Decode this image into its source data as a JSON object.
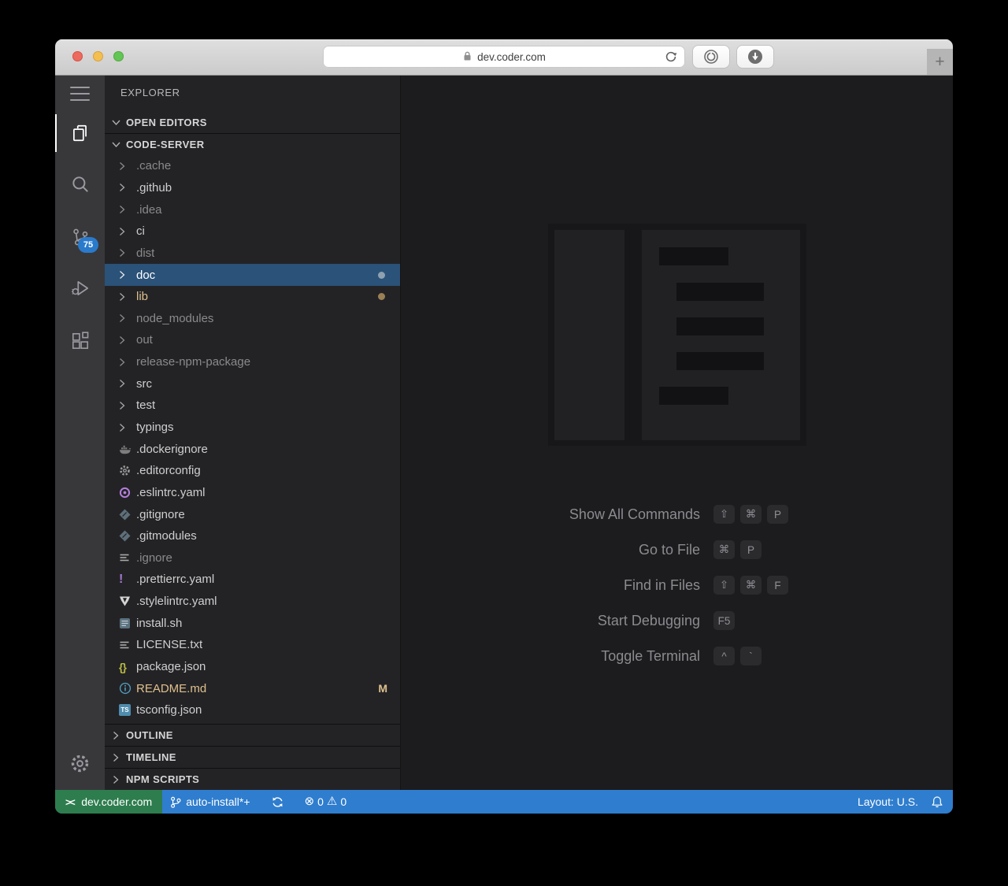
{
  "browser": {
    "url": "dev.coder.com",
    "new_tab_label": "+"
  },
  "activity_bar": {
    "scm_badge": "75",
    "items": [
      "menu",
      "explorer",
      "search",
      "source-control",
      "run-debug",
      "extensions"
    ],
    "bottom_item": "settings"
  },
  "explorer": {
    "title": "EXPLORER",
    "open_editors_label": "OPEN EDITORS",
    "root_label": "CODE-SERVER",
    "tree": [
      {
        "label": ".cache",
        "kind": "folder",
        "dim": true
      },
      {
        "label": ".github",
        "kind": "folder"
      },
      {
        "label": ".idea",
        "kind": "folder",
        "dim": true
      },
      {
        "label": "ci",
        "kind": "folder"
      },
      {
        "label": "dist",
        "kind": "folder",
        "dim": true
      },
      {
        "label": "doc",
        "kind": "folder",
        "selected": true,
        "dot": "#8fa1b0"
      },
      {
        "label": "lib",
        "kind": "folder",
        "color": "#dfc08c",
        "dot": "#9b8055"
      },
      {
        "label": "node_modules",
        "kind": "folder",
        "dim": true
      },
      {
        "label": "out",
        "kind": "folder",
        "dim": true
      },
      {
        "label": "release-npm-package",
        "kind": "folder",
        "dim": true
      },
      {
        "label": "src",
        "kind": "folder"
      },
      {
        "label": "test",
        "kind": "folder"
      },
      {
        "label": "typings",
        "kind": "folder"
      },
      {
        "label": ".dockerignore",
        "kind": "file",
        "icon": "docker-whale-icon"
      },
      {
        "label": ".editorconfig",
        "kind": "file",
        "icon": "gear-file-icon"
      },
      {
        "label": ".eslintrc.yaml",
        "kind": "file",
        "icon": "eslint-icon"
      },
      {
        "label": ".gitignore",
        "kind": "file",
        "icon": "git-diamond-icon"
      },
      {
        "label": ".gitmodules",
        "kind": "file",
        "icon": "git-diamond-icon"
      },
      {
        "label": ".ignore",
        "kind": "file",
        "icon": "text-lines-icon",
        "dim": true
      },
      {
        "label": ".prettierrc.yaml",
        "kind": "file",
        "icon": "yaml-exclamation-icon"
      },
      {
        "label": ".stylelintrc.yaml",
        "kind": "file",
        "icon": "stylelint-shield-icon"
      },
      {
        "label": "install.sh",
        "kind": "file",
        "icon": "shell-script-icon"
      },
      {
        "label": "LICENSE.txt",
        "kind": "file",
        "icon": "text-lines-icon"
      },
      {
        "label": "package.json",
        "kind": "file",
        "icon": "json-braces-icon"
      },
      {
        "label": "README.md",
        "kind": "file",
        "icon": "info-circle-icon",
        "color": "#dfc08c",
        "badge": "M"
      },
      {
        "label": "tsconfig.json",
        "kind": "file",
        "icon": "typescript-icon"
      }
    ],
    "bottom_sections": [
      "OUTLINE",
      "TIMELINE",
      "NPM SCRIPTS"
    ]
  },
  "editor_watermark": {
    "shortcuts": [
      {
        "label": "Show All Commands",
        "keys": [
          "⇧",
          "⌘",
          "P"
        ]
      },
      {
        "label": "Go to File",
        "keys": [
          "⌘",
          "P"
        ]
      },
      {
        "label": "Find in Files",
        "keys": [
          "⇧",
          "⌘",
          "F"
        ]
      },
      {
        "label": "Start Debugging",
        "keys": [
          "F5"
        ]
      },
      {
        "label": "Toggle Terminal",
        "keys": [
          "^",
          "`"
        ]
      }
    ]
  },
  "status_bar": {
    "remote": "dev.coder.com",
    "branch": "auto-install*+",
    "errors": "0",
    "warnings": "0",
    "error_glyph": "⊗",
    "warning_glyph": "⚠",
    "layout": "Layout: U.S.",
    "colors": {
      "remote_bg": "#2e7d4e",
      "bar_bg": "#2f7dce"
    }
  },
  "colors": {
    "selection_bg": "#2b5278",
    "modified_text": "#dfc08c",
    "badge_bg": "#2a7acc"
  }
}
